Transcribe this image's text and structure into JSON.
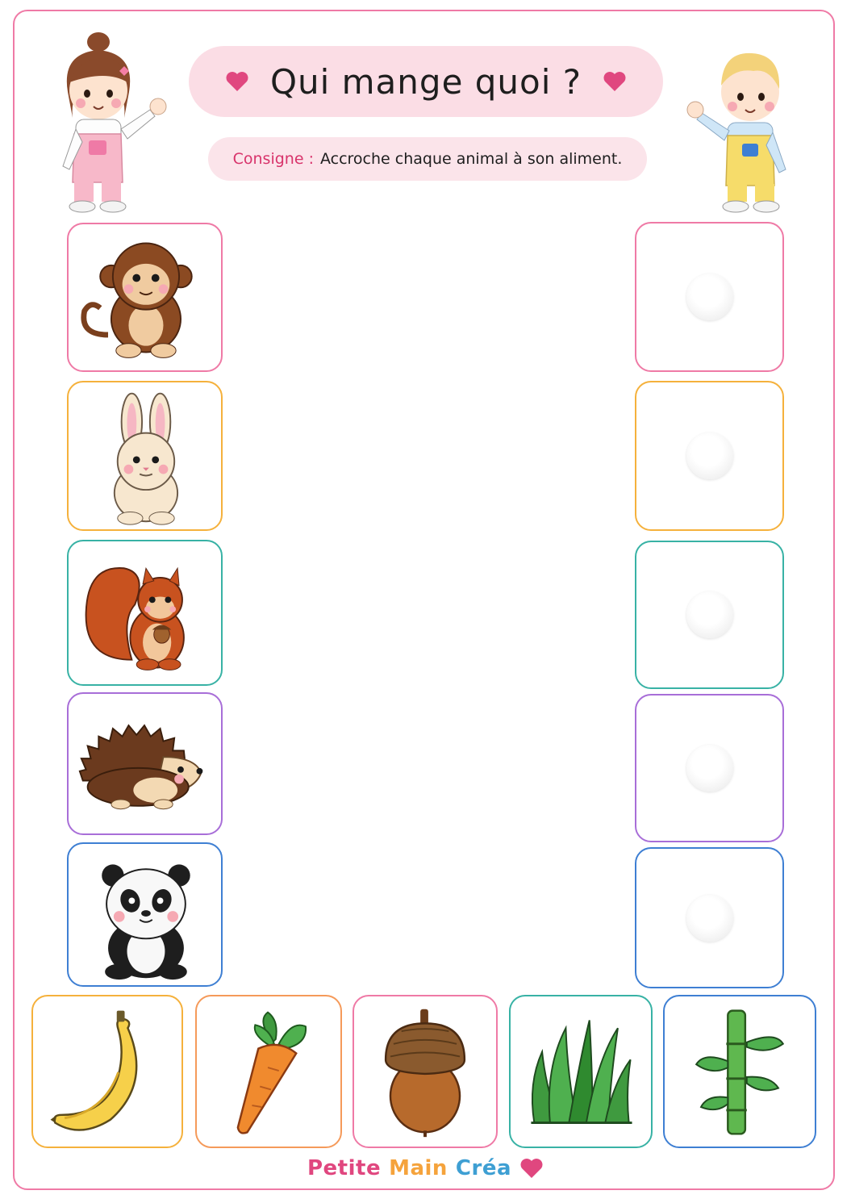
{
  "title": "Qui mange quoi ?",
  "consigne": {
    "label": "Consigne :",
    "text": "Accroche chaque animal à son aliment."
  },
  "colors": {
    "frame": "#ef7aa6",
    "title_bg": "#fbdde5",
    "heart": "#e0477f",
    "pink": "#ef7aa6",
    "orange": "#f5b13c",
    "teal": "#38b2a5",
    "purple": "#a86ed8",
    "blue": "#3e7fd3"
  },
  "animals": [
    {
      "name": "monkey",
      "icon": "monkey-icon",
      "border": "#ef7aa6"
    },
    {
      "name": "rabbit",
      "icon": "rabbit-icon",
      "border": "#f5b13c"
    },
    {
      "name": "squirrel",
      "icon": "squirrel-icon",
      "border": "#38b2a5"
    },
    {
      "name": "hedgehog",
      "icon": "hedgehog-icon",
      "border": "#a86ed8"
    },
    {
      "name": "panda",
      "icon": "panda-icon",
      "border": "#3e7fd3"
    }
  ],
  "foods": [
    {
      "name": "banana",
      "icon": "banana-icon",
      "border": "#f5b13c"
    },
    {
      "name": "carrot",
      "icon": "carrot-icon",
      "border": "#f59a5a"
    },
    {
      "name": "acorn",
      "icon": "acorn-icon",
      "border": "#ef7aa6"
    },
    {
      "name": "grass",
      "icon": "grass-icon",
      "border": "#38b2a5"
    },
    {
      "name": "bamboo",
      "icon": "bamboo-icon",
      "border": "#3e7fd3"
    }
  ],
  "footer": {
    "word1": "Petite",
    "word2": "Main",
    "word3": "Créa"
  }
}
